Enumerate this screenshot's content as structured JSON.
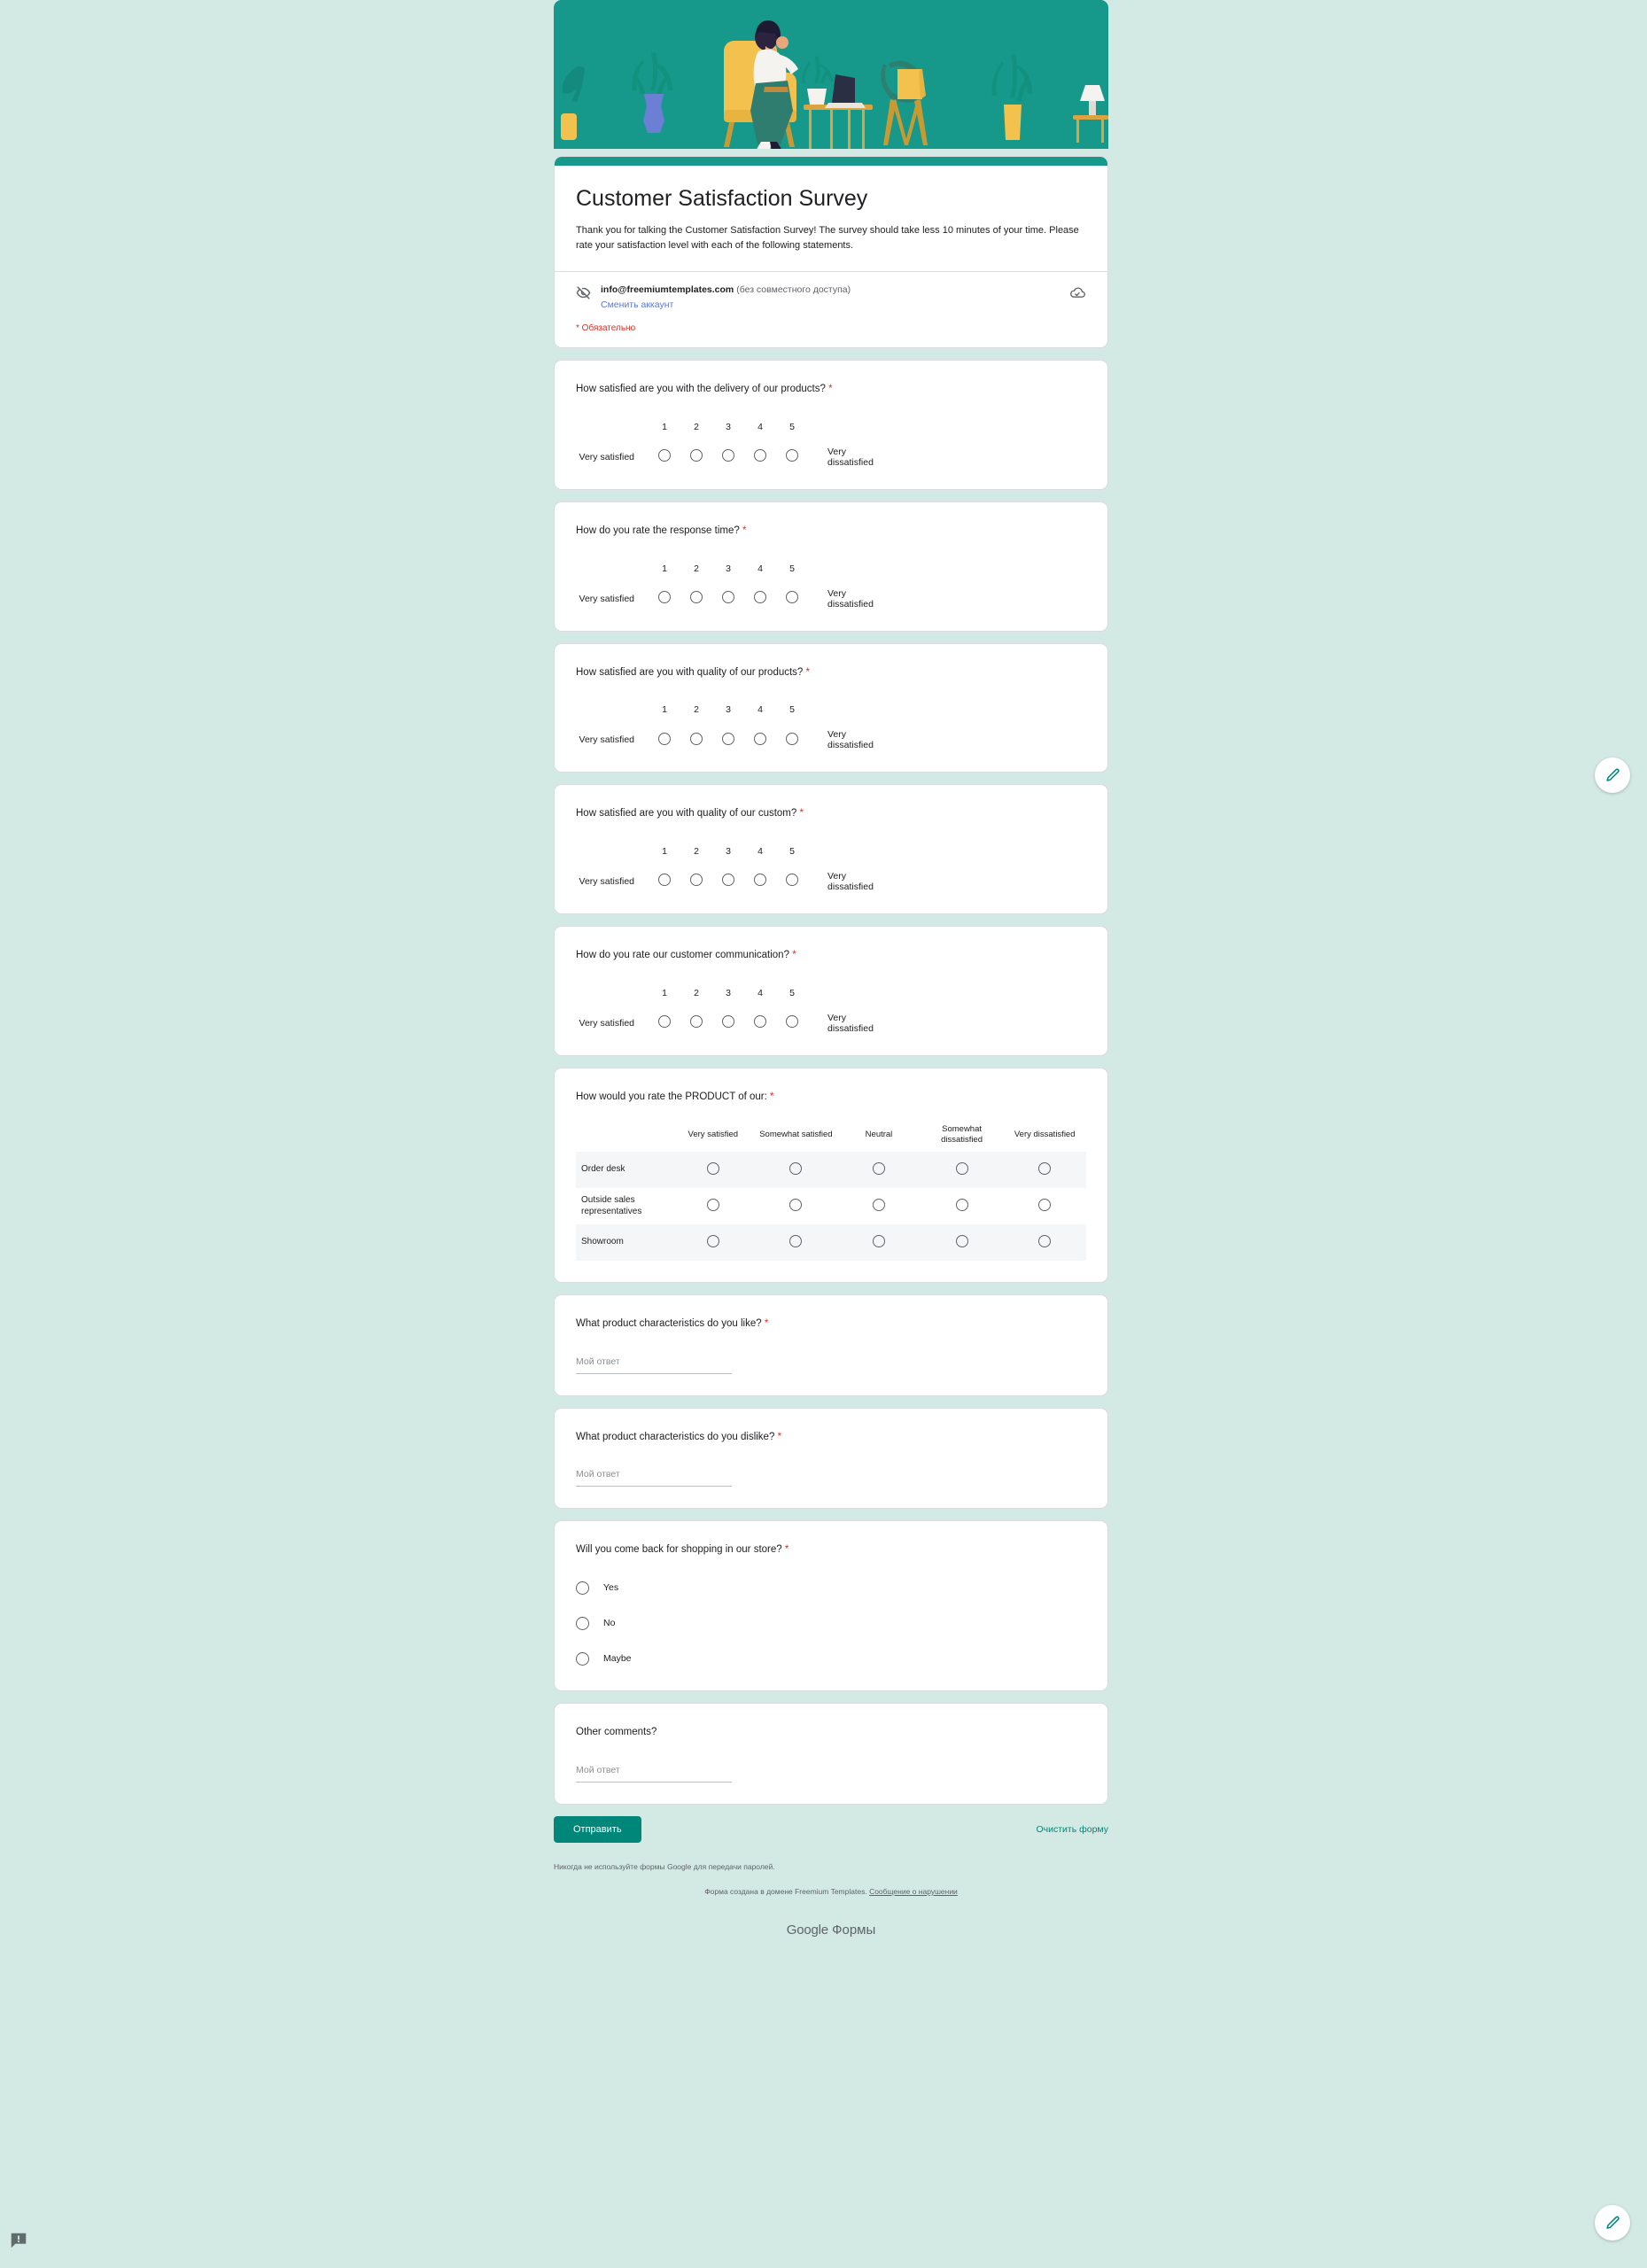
{
  "form": {
    "title": "Customer Satisfaction Survey",
    "description": "Thank you for talking the Customer Satisfaction Survey! The survey should take less 10 minutes of your time. Please rate your satisfaction level with each of the following statements.",
    "account_email": "info@freemiumtemplates.com",
    "account_sharing_note": "(без совместного доступа)",
    "switch_account_label": "Сменить аккаунт",
    "required_note": "* Обязательно",
    "eye_off_icon": "eye-off-icon",
    "cloud_saved_icon": "cloud-done-icon"
  },
  "scale": {
    "left_label": "Very satisfied",
    "right_label": "Very dissatisfied",
    "ticks": [
      "1",
      "2",
      "3",
      "4",
      "5"
    ]
  },
  "questions": [
    {
      "id": "q1",
      "title": "How satisfied are you with the delivery of our products?",
      "required": true,
      "type": "linear_scale"
    },
    {
      "id": "q2",
      "title": "How do you rate the response time?",
      "required": true,
      "type": "linear_scale"
    },
    {
      "id": "q3",
      "title": "How satisfied are you with quality of our products?",
      "required": true,
      "type": "linear_scale"
    },
    {
      "id": "q4",
      "title": "How satisfied are you with quality of our custom?",
      "required": true,
      "type": "linear_scale"
    },
    {
      "id": "q5",
      "title": "How do you rate our customer communication?",
      "required": true,
      "type": "linear_scale"
    }
  ],
  "grid_question": {
    "title": "How would you rate the PRODUCT of our:",
    "required": true,
    "columns": [
      "Very satisfied",
      "Somewhat satisfied",
      "Neutral",
      "Somewhat dissatisfied",
      "Very dissatisfied"
    ],
    "rows": [
      "Order desk",
      "Outside sales representatives",
      "Showroom"
    ]
  },
  "text_questions": [
    {
      "id": "t1",
      "title": "What product characteristics do you like?",
      "required": true,
      "placeholder": "Мой ответ"
    },
    {
      "id": "t2",
      "title": "What product characteristics do you dislike?",
      "required": true,
      "placeholder": "Мой ответ"
    }
  ],
  "choice_question": {
    "title": "Will you come back for shopping in our store?",
    "required": true,
    "options": [
      "Yes",
      "No",
      "Maybe"
    ]
  },
  "final_question": {
    "title": "Other comments?",
    "required": false,
    "placeholder": "Мой ответ"
  },
  "footer": {
    "submit_label": "Отправить",
    "clear_label": "Очистить форму",
    "password_warning": "Никогда не используйте формы Google для передачи паролей.",
    "domain_note": "Форма создана в домене Freemium Templates.",
    "report_link": "Сообщение о нарушении",
    "brand_google": "Google",
    "brand_forms": "Формы"
  },
  "floating": {
    "edit_icon": "pencil-icon",
    "feedback_icon": "feedback-icon"
  },
  "colors": {
    "page_background": "#d3e9e4",
    "banner": "#16998a",
    "accent": "#00877a",
    "required_red": "#d93025",
    "link_blue": "#5b78d6"
  }
}
